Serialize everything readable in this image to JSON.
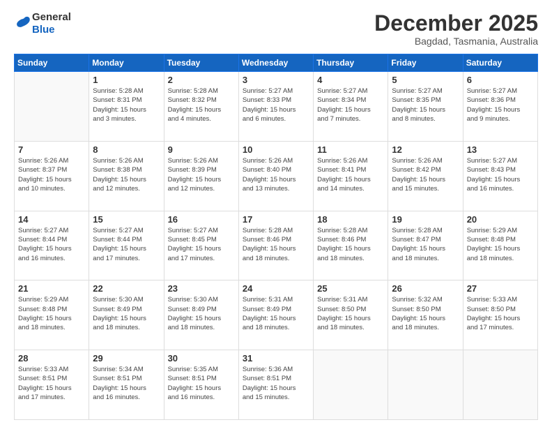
{
  "header": {
    "logo_line1": "General",
    "logo_line2": "Blue",
    "month": "December 2025",
    "location": "Bagdad, Tasmania, Australia"
  },
  "weekdays": [
    "Sunday",
    "Monday",
    "Tuesday",
    "Wednesday",
    "Thursday",
    "Friday",
    "Saturday"
  ],
  "weeks": [
    [
      {
        "day": "",
        "info": ""
      },
      {
        "day": "1",
        "info": "Sunrise: 5:28 AM\nSunset: 8:31 PM\nDaylight: 15 hours\nand 3 minutes."
      },
      {
        "day": "2",
        "info": "Sunrise: 5:28 AM\nSunset: 8:32 PM\nDaylight: 15 hours\nand 4 minutes."
      },
      {
        "day": "3",
        "info": "Sunrise: 5:27 AM\nSunset: 8:33 PM\nDaylight: 15 hours\nand 6 minutes."
      },
      {
        "day": "4",
        "info": "Sunrise: 5:27 AM\nSunset: 8:34 PM\nDaylight: 15 hours\nand 7 minutes."
      },
      {
        "day": "5",
        "info": "Sunrise: 5:27 AM\nSunset: 8:35 PM\nDaylight: 15 hours\nand 8 minutes."
      },
      {
        "day": "6",
        "info": "Sunrise: 5:27 AM\nSunset: 8:36 PM\nDaylight: 15 hours\nand 9 minutes."
      }
    ],
    [
      {
        "day": "7",
        "info": "Sunrise: 5:26 AM\nSunset: 8:37 PM\nDaylight: 15 hours\nand 10 minutes."
      },
      {
        "day": "8",
        "info": "Sunrise: 5:26 AM\nSunset: 8:38 PM\nDaylight: 15 hours\nand 12 minutes."
      },
      {
        "day": "9",
        "info": "Sunrise: 5:26 AM\nSunset: 8:39 PM\nDaylight: 15 hours\nand 12 minutes."
      },
      {
        "day": "10",
        "info": "Sunrise: 5:26 AM\nSunset: 8:40 PM\nDaylight: 15 hours\nand 13 minutes."
      },
      {
        "day": "11",
        "info": "Sunrise: 5:26 AM\nSunset: 8:41 PM\nDaylight: 15 hours\nand 14 minutes."
      },
      {
        "day": "12",
        "info": "Sunrise: 5:26 AM\nSunset: 8:42 PM\nDaylight: 15 hours\nand 15 minutes."
      },
      {
        "day": "13",
        "info": "Sunrise: 5:27 AM\nSunset: 8:43 PM\nDaylight: 15 hours\nand 16 minutes."
      }
    ],
    [
      {
        "day": "14",
        "info": "Sunrise: 5:27 AM\nSunset: 8:44 PM\nDaylight: 15 hours\nand 16 minutes."
      },
      {
        "day": "15",
        "info": "Sunrise: 5:27 AM\nSunset: 8:44 PM\nDaylight: 15 hours\nand 17 minutes."
      },
      {
        "day": "16",
        "info": "Sunrise: 5:27 AM\nSunset: 8:45 PM\nDaylight: 15 hours\nand 17 minutes."
      },
      {
        "day": "17",
        "info": "Sunrise: 5:28 AM\nSunset: 8:46 PM\nDaylight: 15 hours\nand 18 minutes."
      },
      {
        "day": "18",
        "info": "Sunrise: 5:28 AM\nSunset: 8:46 PM\nDaylight: 15 hours\nand 18 minutes."
      },
      {
        "day": "19",
        "info": "Sunrise: 5:28 AM\nSunset: 8:47 PM\nDaylight: 15 hours\nand 18 minutes."
      },
      {
        "day": "20",
        "info": "Sunrise: 5:29 AM\nSunset: 8:48 PM\nDaylight: 15 hours\nand 18 minutes."
      }
    ],
    [
      {
        "day": "21",
        "info": "Sunrise: 5:29 AM\nSunset: 8:48 PM\nDaylight: 15 hours\nand 18 minutes."
      },
      {
        "day": "22",
        "info": "Sunrise: 5:30 AM\nSunset: 8:49 PM\nDaylight: 15 hours\nand 18 minutes."
      },
      {
        "day": "23",
        "info": "Sunrise: 5:30 AM\nSunset: 8:49 PM\nDaylight: 15 hours\nand 18 minutes."
      },
      {
        "day": "24",
        "info": "Sunrise: 5:31 AM\nSunset: 8:49 PM\nDaylight: 15 hours\nand 18 minutes."
      },
      {
        "day": "25",
        "info": "Sunrise: 5:31 AM\nSunset: 8:50 PM\nDaylight: 15 hours\nand 18 minutes."
      },
      {
        "day": "26",
        "info": "Sunrise: 5:32 AM\nSunset: 8:50 PM\nDaylight: 15 hours\nand 18 minutes."
      },
      {
        "day": "27",
        "info": "Sunrise: 5:33 AM\nSunset: 8:50 PM\nDaylight: 15 hours\nand 17 minutes."
      }
    ],
    [
      {
        "day": "28",
        "info": "Sunrise: 5:33 AM\nSunset: 8:51 PM\nDaylight: 15 hours\nand 17 minutes."
      },
      {
        "day": "29",
        "info": "Sunrise: 5:34 AM\nSunset: 8:51 PM\nDaylight: 15 hours\nand 16 minutes."
      },
      {
        "day": "30",
        "info": "Sunrise: 5:35 AM\nSunset: 8:51 PM\nDaylight: 15 hours\nand 16 minutes."
      },
      {
        "day": "31",
        "info": "Sunrise: 5:36 AM\nSunset: 8:51 PM\nDaylight: 15 hours\nand 15 minutes."
      },
      {
        "day": "",
        "info": ""
      },
      {
        "day": "",
        "info": ""
      },
      {
        "day": "",
        "info": ""
      }
    ]
  ]
}
